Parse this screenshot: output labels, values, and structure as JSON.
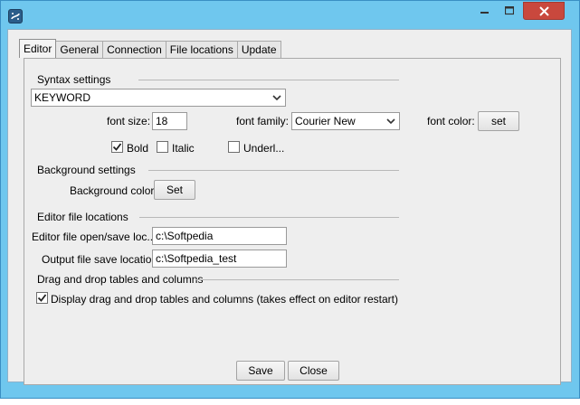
{
  "tabs": [
    "Editor",
    "General",
    "Connection",
    "File locations",
    "Update"
  ],
  "syntax": {
    "heading": "Syntax settings",
    "selected": "KEYWORD",
    "font_size_label": "font size:",
    "font_size_value": "18",
    "font_family_label": "font family:",
    "font_family_value": "Courier New",
    "font_color_label": "font color:",
    "font_color_button": "set",
    "bold_label": "Bold",
    "bold_checked": true,
    "italic_label": "Italic",
    "italic_checked": false,
    "underline_label": "Underl...",
    "underline_checked": false
  },
  "background": {
    "heading": "Background settings",
    "color_label": "Background color:",
    "set_button": "Set"
  },
  "file_locations": {
    "heading": "Editor file locations",
    "open_save_label": "Editor file open/save loc...",
    "open_save_value": "c:\\Softpedia",
    "output_label": "Output file save location",
    "output_value": "c:\\Softpedia_test"
  },
  "dragdrop": {
    "heading": "Drag and drop tables and columns",
    "checkbox_label": "Display drag and drop tables and columns (takes effect on editor restart)",
    "checked": true
  },
  "buttons": {
    "save": "Save",
    "close": "Close"
  },
  "colors": {
    "frame": "#6fc7ee",
    "close_button": "#c9483d",
    "panel": "#eeeeee"
  }
}
